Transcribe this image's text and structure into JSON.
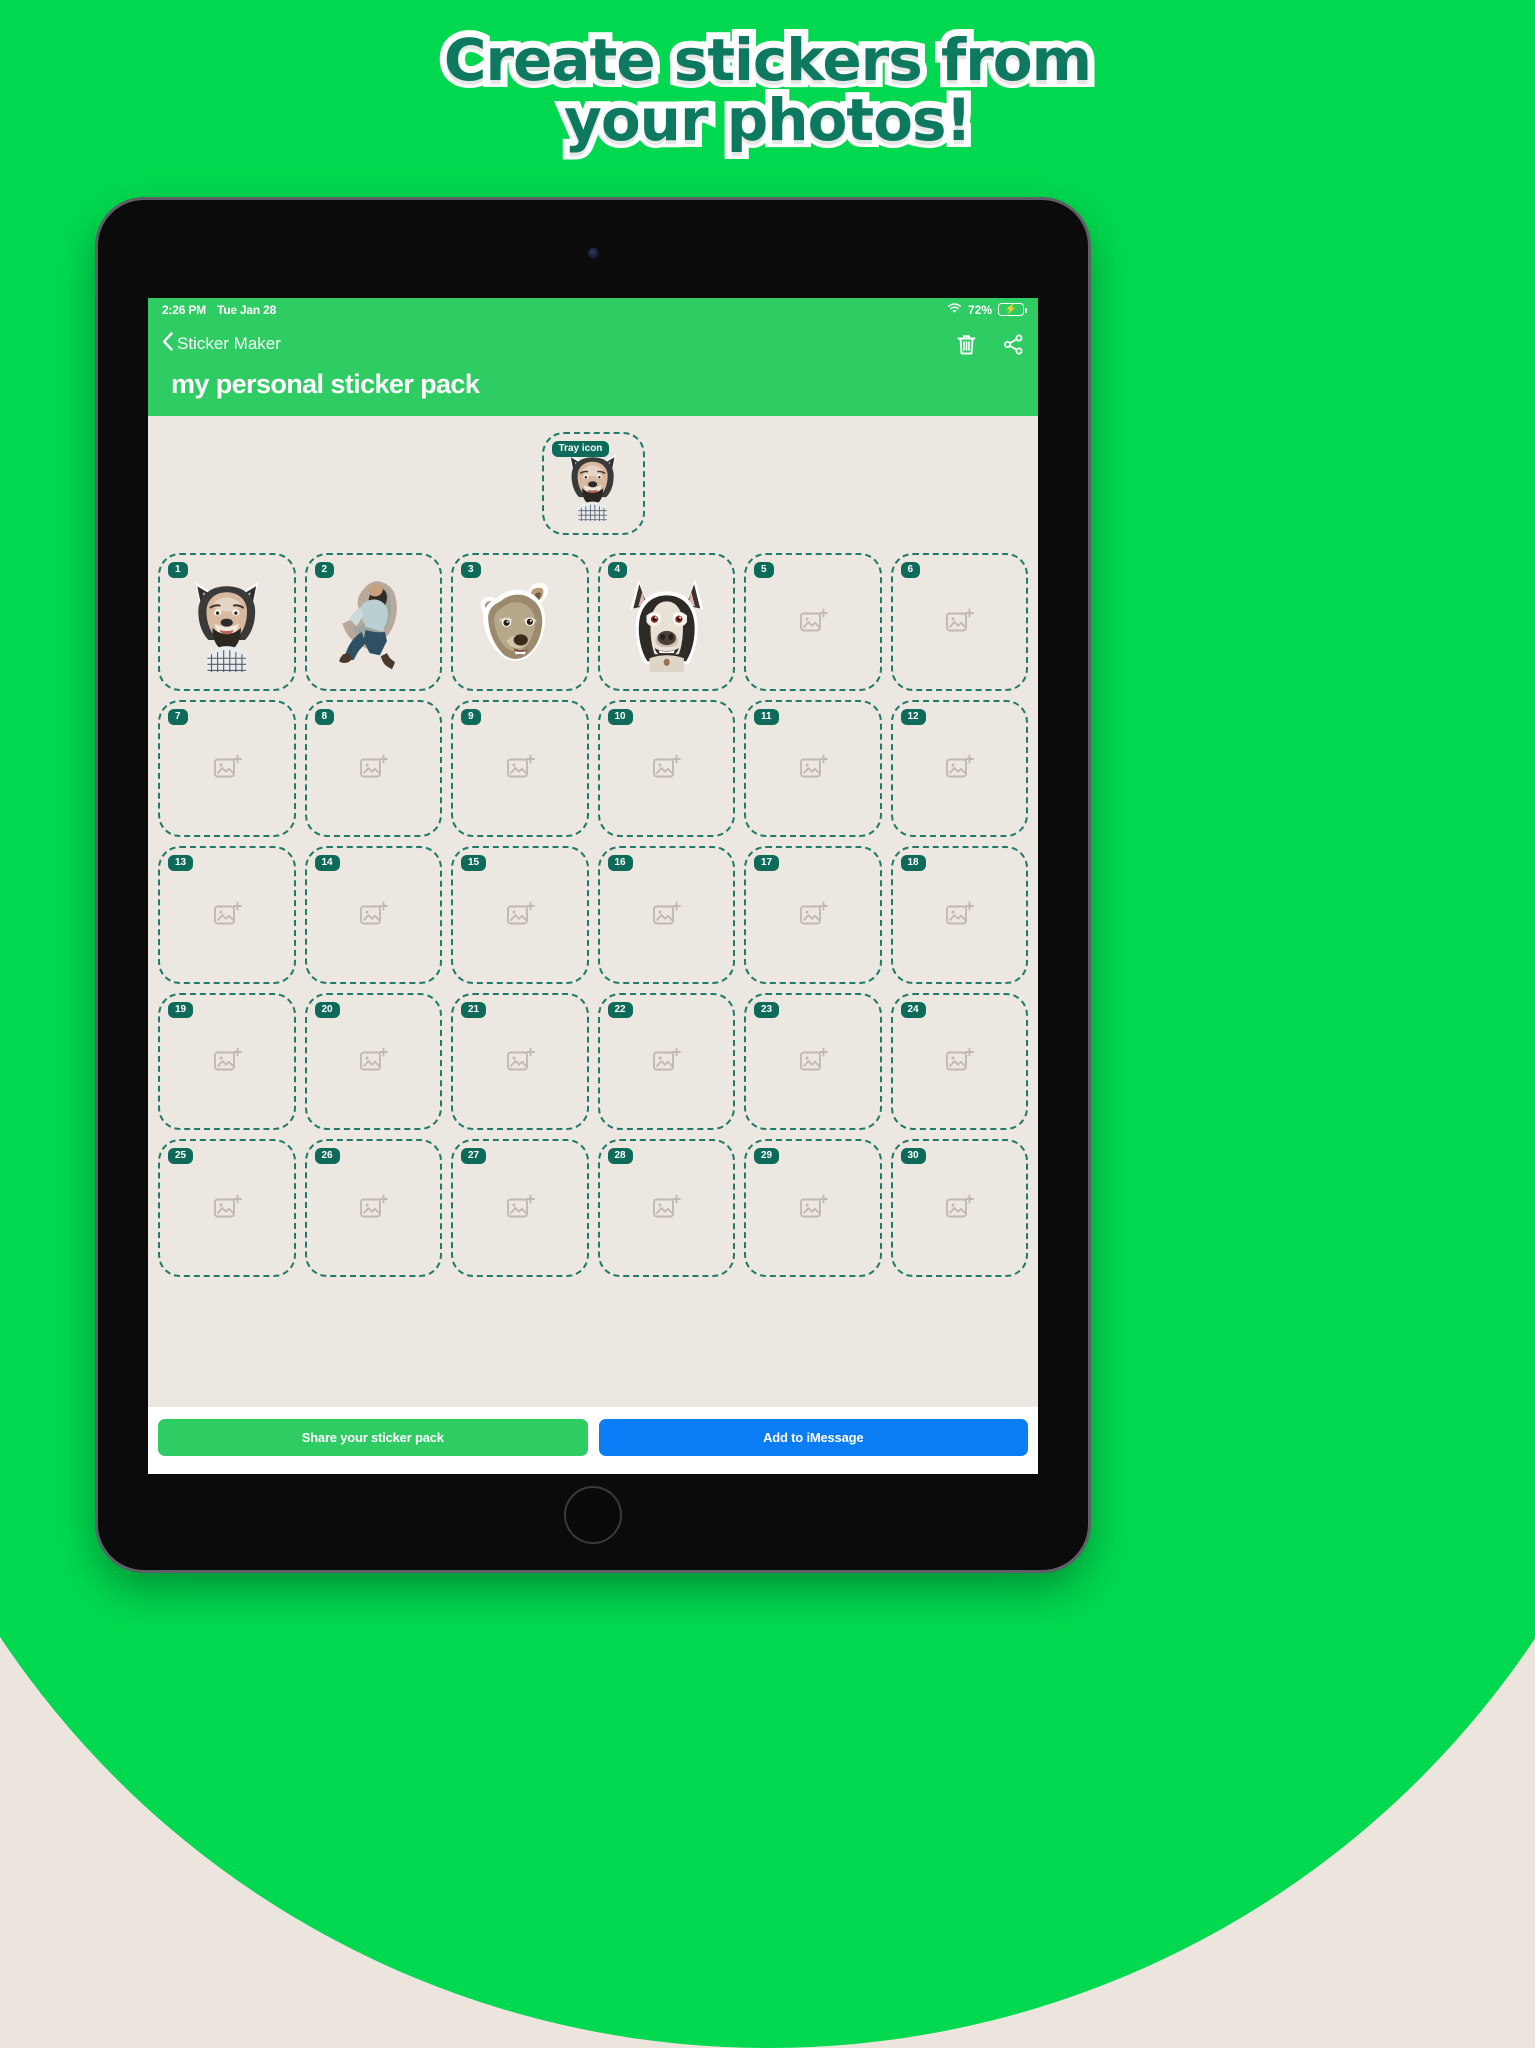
{
  "promo": {
    "headline_line1": "Create stickers from",
    "headline_line2": "your photos!",
    "bg_green": "#00d94f",
    "bg_cream": "#ece5dd",
    "headline_fill": "#0d7a5f",
    "headline_outline": "#ffffff"
  },
  "status_bar": {
    "time": "2:26 PM",
    "date": "Tue Jan 28",
    "wifi_icon": "wifi-icon",
    "battery_percent": "72%",
    "battery_icon": "battery-charging-icon",
    "bolt_glyph": "⚡"
  },
  "nav": {
    "back_icon": "chevron-left-icon",
    "back_label": "Sticker Maker",
    "delete_icon": "trash-icon",
    "share_icon": "share-icon",
    "accent": "#2ecc63"
  },
  "header": {
    "pack_title": "my personal sticker pack"
  },
  "tray": {
    "badge_label": "Tray icon",
    "image_name": "wolf-face-man-sticker",
    "filled": true
  },
  "grid": {
    "columns": 6,
    "rows": 5,
    "placeholder_icon": "add-photo-icon",
    "badge_color": "#0e6b5a",
    "dash_color": "#1f7a66",
    "slots": [
      {
        "number": "1",
        "filled": true,
        "image_name": "wolf-face-man-sticker"
      },
      {
        "number": "2",
        "filled": true,
        "image_name": "jumping-man-sticker"
      },
      {
        "number": "3",
        "filled": true,
        "image_name": "wolf-head-sticker"
      },
      {
        "number": "4",
        "filled": true,
        "image_name": "husky-face-sticker"
      },
      {
        "number": "5",
        "filled": false,
        "image_name": ""
      },
      {
        "number": "6",
        "filled": false,
        "image_name": ""
      },
      {
        "number": "7",
        "filled": false,
        "image_name": ""
      },
      {
        "number": "8",
        "filled": false,
        "image_name": ""
      },
      {
        "number": "9",
        "filled": false,
        "image_name": ""
      },
      {
        "number": "10",
        "filled": false,
        "image_name": ""
      },
      {
        "number": "11",
        "filled": false,
        "image_name": ""
      },
      {
        "number": "12",
        "filled": false,
        "image_name": ""
      },
      {
        "number": "13",
        "filled": false,
        "image_name": ""
      },
      {
        "number": "14",
        "filled": false,
        "image_name": ""
      },
      {
        "number": "15",
        "filled": false,
        "image_name": ""
      },
      {
        "number": "16",
        "filled": false,
        "image_name": ""
      },
      {
        "number": "17",
        "filled": false,
        "image_name": ""
      },
      {
        "number": "18",
        "filled": false,
        "image_name": ""
      },
      {
        "number": "19",
        "filled": false,
        "image_name": ""
      },
      {
        "number": "20",
        "filled": false,
        "image_name": ""
      },
      {
        "number": "21",
        "filled": false,
        "image_name": ""
      },
      {
        "number": "22",
        "filled": false,
        "image_name": ""
      },
      {
        "number": "23",
        "filled": false,
        "image_name": ""
      },
      {
        "number": "24",
        "filled": false,
        "image_name": ""
      },
      {
        "number": "25",
        "filled": false,
        "image_name": ""
      },
      {
        "number": "26",
        "filled": false,
        "image_name": ""
      },
      {
        "number": "27",
        "filled": false,
        "image_name": ""
      },
      {
        "number": "28",
        "filled": false,
        "image_name": ""
      },
      {
        "number": "29",
        "filled": false,
        "image_name": ""
      },
      {
        "number": "30",
        "filled": false,
        "image_name": ""
      }
    ]
  },
  "footer": {
    "share_label": "Share your sticker pack",
    "share_color": "#2ecc63",
    "imessage_label": "Add to iMessage",
    "imessage_color": "#0a7cf4"
  }
}
